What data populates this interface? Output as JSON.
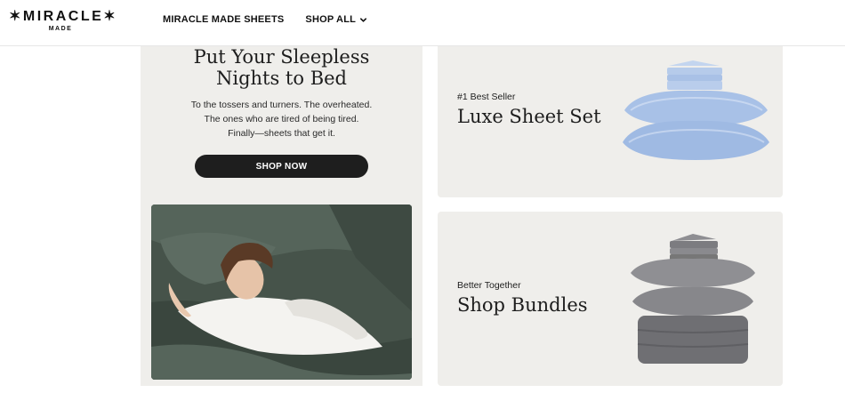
{
  "header": {
    "logo_main": "✶MIRACLE✶",
    "logo_sub": "MADE",
    "nav": [
      {
        "label": "MIRACLE MADE SHEETS"
      },
      {
        "label": "SHOP ALL"
      }
    ]
  },
  "hero": {
    "title_line1": "Put Your Sleepless",
    "title_line2": "Nights to Bed",
    "text_line1": "To the tossers and turners. The overheated.",
    "text_line2": "The ones who are tired of being tired.",
    "text_line3": "Finally—sheets that get it.",
    "button": "SHOP NOW"
  },
  "cards": [
    {
      "kicker": "#1 Best Seller",
      "title": "Luxe Sheet Set",
      "color": "#a9c2e6"
    },
    {
      "kicker": "Better Together",
      "title": "Shop Bundles",
      "color": "#8f8f92"
    }
  ],
  "colors": {
    "panel": "#efeeeb",
    "button": "#1e1e1e",
    "sheet_green": "#4b5a50"
  }
}
